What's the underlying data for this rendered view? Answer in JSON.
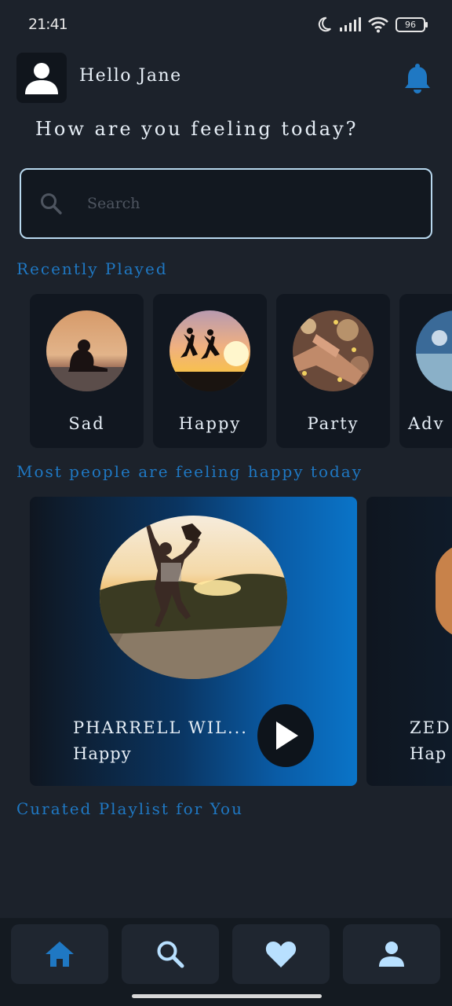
{
  "status_bar": {
    "time": "21:41",
    "battery": "96",
    "icons": [
      "moon-icon",
      "signal-icon",
      "wifi-icon",
      "battery-icon"
    ]
  },
  "header": {
    "greeting": "Hello Jane",
    "question": "How are you feeling today?",
    "avatar_icon": "user-icon",
    "notification_icon": "bell-icon"
  },
  "search": {
    "placeholder": "Search",
    "value": ""
  },
  "recently_played": {
    "title": "Recently Played",
    "items": [
      {
        "label": "Sad"
      },
      {
        "label": "Happy"
      },
      {
        "label": "Party"
      },
      {
        "label": "Adv"
      }
    ]
  },
  "featured": {
    "title": "Most people are feeling happy today",
    "cards": [
      {
        "artist": "PHARRELL WIL...",
        "song": "Happy"
      },
      {
        "artist": "ZED",
        "song": "Hap"
      }
    ]
  },
  "curated": {
    "title": "Curated Playlist for You"
  },
  "bottom_nav": {
    "items": [
      "home-icon",
      "search-icon",
      "heart-icon",
      "profile-icon"
    ]
  },
  "colors": {
    "background": "#1c222b",
    "accent": "#1f78c3",
    "card": "#111720"
  }
}
